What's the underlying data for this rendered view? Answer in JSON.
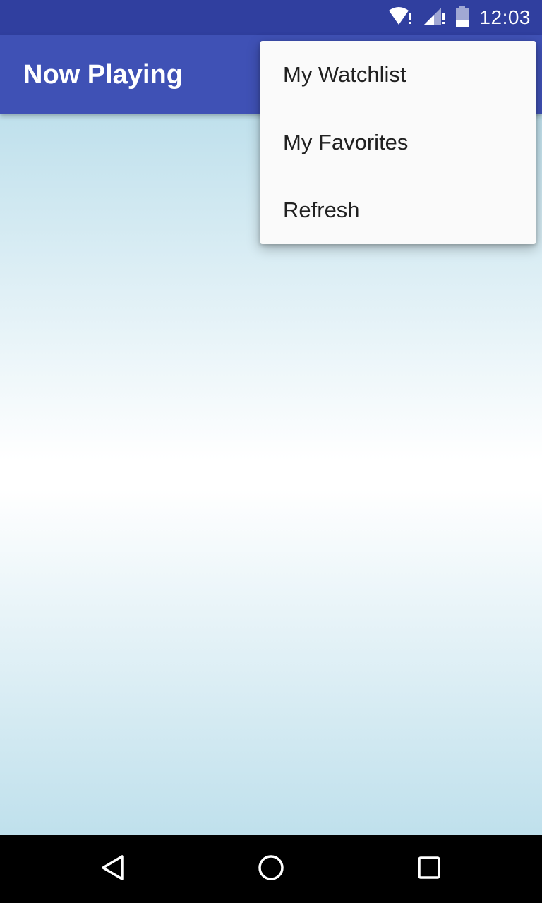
{
  "status_bar": {
    "time": "12:03",
    "icons": [
      "wifi-icon",
      "cell-signal-icon",
      "battery-icon"
    ]
  },
  "app_bar": {
    "title": "Now Playing"
  },
  "overflow_menu": {
    "items": [
      {
        "label": "My Watchlist"
      },
      {
        "label": "My Favorites"
      },
      {
        "label": "Refresh"
      }
    ]
  },
  "nav_bar": {
    "icons": [
      "back-icon",
      "home-icon",
      "recents-icon"
    ]
  },
  "colors": {
    "status_bar": "#303f9f",
    "app_bar": "#3f51b5",
    "menu_bg": "#fafafa",
    "background_gradient_edge": "#bfe0ec"
  }
}
